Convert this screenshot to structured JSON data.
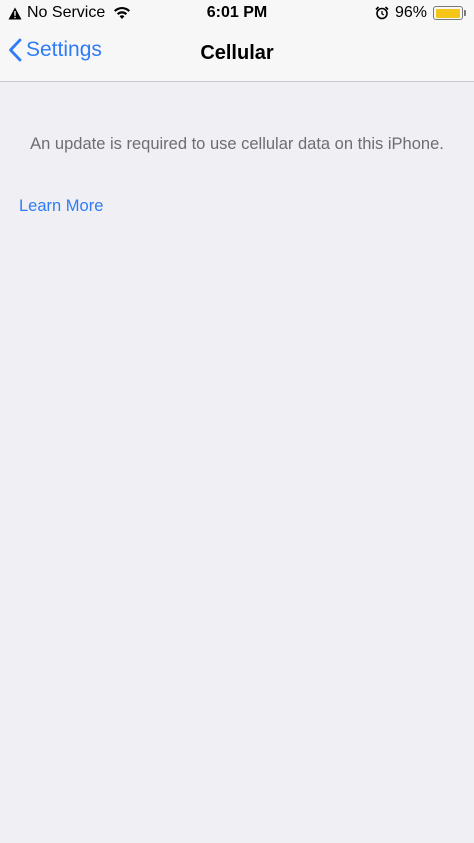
{
  "status_bar": {
    "carrier": "No Service",
    "time": "6:01 PM",
    "battery_percent": "96%",
    "battery_level": 0.96,
    "battery_color": "#f5c518"
  },
  "nav": {
    "back_label": "Settings",
    "title": "Cellular"
  },
  "content": {
    "message": "An update is required to use cellular data on this iPhone.",
    "link": "Learn More"
  },
  "colors": {
    "accent": "#2f7cf6",
    "background": "#efeff4",
    "secondary_text": "#6d6d72"
  },
  "icons": [
    "warning-icon",
    "wifi-icon",
    "alarm-icon",
    "battery-icon",
    "chevron-left-icon"
  ]
}
